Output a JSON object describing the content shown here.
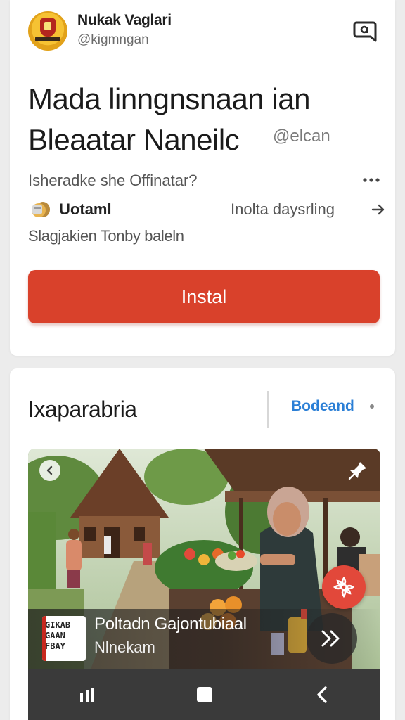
{
  "header": {
    "account_name": "Nukak Vaglari",
    "account_handle": "@kigmngan",
    "avatar_icon": "crest-logo",
    "chat_icon": "chat-bubble-icon"
  },
  "app": {
    "title_line1": "Mada linngnsnaan ian",
    "title_line2": "Bleaatar Naneilc",
    "title_tag": "@elcan",
    "subtitle": "Isheradke she Offinatar?",
    "update_label": "Uotaml",
    "update_info": "Inolta daysrling",
    "footnote": "Slagjakien Tonby baleln",
    "install_label": "Instal",
    "install_color": "#d9412b"
  },
  "section": {
    "title": "Ixaparabria",
    "link_label": "Bodeand",
    "link_color": "#2b7fd6"
  },
  "media": {
    "caption_title": "Poltadn Gajontubiaal",
    "caption_sub": "Nlnekam",
    "logo_text": "GIKAB GAAN FBAY",
    "fab_icon": "flower-icon",
    "fab_color": "#e2483a"
  },
  "nav": {
    "items": [
      "recent-apps-icon",
      "home-icon",
      "back-icon"
    ]
  }
}
